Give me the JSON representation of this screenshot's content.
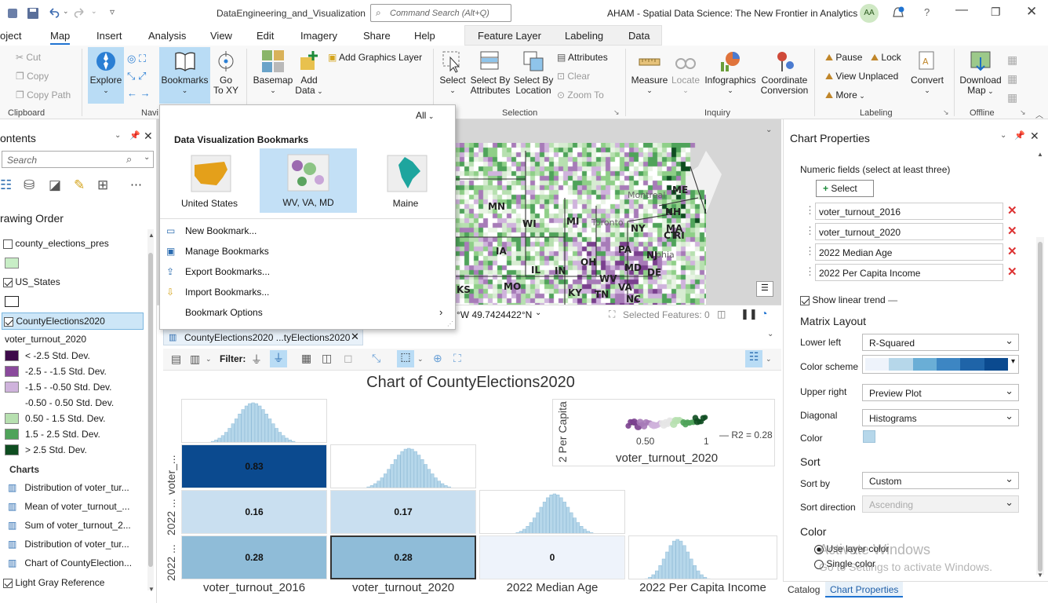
{
  "titlebar": {
    "project_name": "DataEngineering_and_Visualization",
    "command_search_placeholder": "Command Search (Alt+Q)",
    "app_title": "AHAM - Spatial Data Science:  The New Frontier in Analytics",
    "user_initials": "AA"
  },
  "ribbon_tabs": [
    "oject",
    "Map",
    "Insert",
    "Analysis",
    "View",
    "Edit",
    "Imagery",
    "Share",
    "Help",
    "Feature Layer",
    "Labeling",
    "Data"
  ],
  "ribbon": {
    "clipboard": {
      "cut": "Cut",
      "copy": "Copy",
      "copy_path": "Copy Path",
      "group": "Clipboard"
    },
    "navigate": {
      "explore": "Explore",
      "bookmarks": "Bookmarks",
      "go_to": "Go",
      "go_to2": "To XY",
      "group": "Navi"
    },
    "layer": {
      "basemap": "Basemap",
      "add_data": "Add",
      "add_data2": "Data",
      "add_graphics": "Add Graphics Layer"
    },
    "selection": {
      "select": "Select",
      "select_by_attr": "Select By",
      "select_by_attr2": "Attributes",
      "select_by_loc": "Select By",
      "select_by_loc2": "Location",
      "attributes": "Attributes",
      "clear": "Clear",
      "zoom_to": "Zoom To",
      "group": "Selection"
    },
    "inquiry": {
      "measure": "Measure",
      "locate": "Locate",
      "infographics": "Infographics",
      "coord": "Coordinate",
      "coord2": "Conversion",
      "group": "Inquiry"
    },
    "labeling": {
      "pause": "Pause",
      "lock": "Lock",
      "view_unplaced": "View Unplaced",
      "more": "More",
      "convert": "Convert",
      "group": "Labeling"
    },
    "offline": {
      "download": "Download",
      "download2": "Map",
      "group": "Offline"
    }
  },
  "contents": {
    "title": "ontents",
    "search_placeholder": "Search",
    "drawing_order": "rawing Order",
    "layers": [
      {
        "name": "county_elections_pres",
        "checked": false
      },
      {
        "name": "US_States",
        "checked": true
      },
      {
        "name": "CountyElections2020",
        "checked": true
      }
    ],
    "legend_field": "voter_turnout_2020",
    "legend": [
      {
        "label": "< -2.5 Std. Dev.",
        "color": "#3d0a4a"
      },
      {
        "label": "-2.5 - -1.5 Std. Dev.",
        "color": "#8a4a9c"
      },
      {
        "label": "-1.5 - -0.50 Std. Dev.",
        "color": "#cfb3dc"
      },
      {
        "label": "-0.50 - 0.50 Std. Dev.",
        "color": "#ffffff"
      },
      {
        "label": "0.50 - 1.5 Std. Dev.",
        "color": "#b7e0b0"
      },
      {
        "label": "1.5 - 2.5 Std. Dev.",
        "color": "#4fa35a"
      },
      {
        "label": "> 2.5 Std. Dev.",
        "color": "#0e4d20"
      }
    ],
    "charts_header": "Charts",
    "charts": [
      "Distribution of voter_tur...",
      "Mean of voter_turnout_...",
      "Sum of voter_turnout_2...",
      "Distribution of voter_tur...",
      "Chart of CountyElection..."
    ],
    "basemap": "Light Gray Reference"
  },
  "bookmarks_popup": {
    "filter": "All",
    "header": "Data Visualization Bookmarks",
    "items": [
      "United States",
      "WV, VA, MD",
      "Maine"
    ],
    "menu": [
      "New Bookmark...",
      "Manage Bookmarks",
      "Export Bookmarks...",
      "Import Bookmarks...",
      "Bookmark Options"
    ]
  },
  "map": {
    "labels": [
      "MN",
      "WI",
      "MI",
      "IA",
      "IL",
      "IN",
      "OH",
      "PA",
      "NY",
      "ME",
      "NH",
      "MA",
      "CT",
      "RI",
      "NJ",
      "DE",
      "MD",
      "WV",
      "VA",
      "KY",
      "TN",
      "MO",
      "KS",
      "NC",
      "Montreal",
      "Toronto",
      "phia"
    ],
    "coordinate": "°W 49.7424422°N",
    "selected_features": "Selected Features: 0"
  },
  "chart_pane": {
    "tab_label": "CountyElections2020 ...tyElections2020",
    "filter_label": "Filter:",
    "title": "Chart of CountyElections2020",
    "x_labels": [
      "voter_turnout_2016",
      "voter_turnout_2020",
      "2022 Median Age",
      "2022 Per Capita Income"
    ],
    "y_labels": [
      "voter_...",
      "2022 ...",
      "2022 ..."
    ],
    "preview_ylabel": "2 Per Capita",
    "preview_xlabel": "voter_turnout_2020",
    "preview_ticks": [
      "0.50",
      "1"
    ],
    "preview_legend": "R2 = 0.28"
  },
  "chart_data": {
    "type": "heatmap",
    "title": "Chart of CountyElections2020",
    "variables": [
      "voter_turnout_2016",
      "voter_turnout_2020",
      "2022 Median Age",
      "2022 Per Capita Income"
    ],
    "r_squared": [
      {
        "row": "voter_turnout_2020",
        "col": "voter_turnout_2016",
        "value": 0.83
      },
      {
        "row": "2022 Median Age",
        "col": "voter_turnout_2016",
        "value": 0.16
      },
      {
        "row": "2022 Median Age",
        "col": "voter_turnout_2020",
        "value": 0.17
      },
      {
        "row": "2022 Per Capita Income",
        "col": "voter_turnout_2016",
        "value": 0.28
      },
      {
        "row": "2022 Per Capita Income",
        "col": "voter_turnout_2020",
        "value": 0.28
      },
      {
        "row": "2022 Per Capita Income",
        "col": "2022 Median Age",
        "value": 0
      }
    ],
    "cell_labels": [
      "0.83",
      "0.16",
      "0.17",
      "0.28",
      "0.28",
      "0"
    ]
  },
  "chart_properties": {
    "title": "Chart Properties",
    "numeric_fields_label": "Numeric fields (select at least three)",
    "select_button": "Select",
    "fields": [
      "voter_turnout_2016",
      "voter_turnout_2020",
      "2022 Median Age",
      "2022 Per Capita Income"
    ],
    "show_trend": "Show linear trend",
    "matrix_layout": "Matrix Layout",
    "lower_left_label": "Lower left",
    "lower_left_value": "R-Squared",
    "color_scheme_label": "Color scheme",
    "upper_right_label": "Upper right",
    "upper_right_value": "Preview Plot",
    "diagonal_label": "Diagonal",
    "diagonal_value": "Histograms",
    "color_label": "Color",
    "sort_header": "Sort",
    "sort_by_label": "Sort by",
    "sort_by_value": "Custom",
    "sort_dir_label": "Sort direction",
    "sort_dir_value": "Ascending",
    "color_header": "Color",
    "use_layer_color": "Use layer color",
    "single_color": "Single color",
    "watermark1": "Activate Windows",
    "watermark2": "Go to Settings to activate Windows.",
    "bottom_tabs": [
      "Catalog",
      "Chart Properties"
    ]
  }
}
